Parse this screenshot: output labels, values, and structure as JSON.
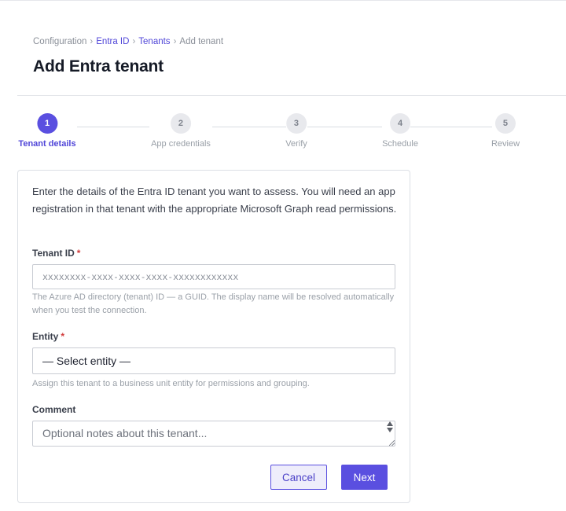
{
  "breadcrumb": {
    "items": [
      "Configuration",
      "Entra ID",
      "Tenants",
      "Add tenant"
    ],
    "separator": "›"
  },
  "page": {
    "title": "Add Entra tenant"
  },
  "stepper": {
    "steps": [
      {
        "number": "1",
        "label": "Tenant details",
        "state": "active"
      },
      {
        "number": "2",
        "label": "App credentials",
        "state": "upcoming"
      },
      {
        "number": "3",
        "label": "Verify",
        "state": "upcoming"
      },
      {
        "number": "4",
        "label": "Schedule",
        "state": "upcoming"
      },
      {
        "number": "5",
        "label": "Review",
        "state": "upcoming"
      }
    ]
  },
  "form": {
    "intro": "Enter the details of the Entra ID tenant you want to assess. You will need an app registration in that tenant with the appropriate Microsoft Graph read permissions.",
    "tenant_id": {
      "label": "Tenant ID",
      "required_mark": "*",
      "value": "",
      "placeholder": "xxxxxxxx-xxxx-xxxx-xxxx-xxxxxxxxxxxx",
      "help": "The Azure AD directory (tenant) ID — a GUID. The display name will be resolved automatically when you test the connection."
    },
    "entity": {
      "label": "Entity",
      "required_mark": "*",
      "selected": "— Select entity —",
      "help": "Assign this tenant to a business unit entity for permissions and grouping."
    },
    "comment": {
      "label": "Comment",
      "value": "",
      "placeholder": "Optional notes about this tenant..."
    },
    "buttons": {
      "cancel": "Cancel",
      "next": "Next"
    }
  },
  "colors": {
    "accent": "#5a4fe0",
    "link": "#5046d8",
    "required": "#d23c3c",
    "muted_text": "#9aa0a8"
  }
}
